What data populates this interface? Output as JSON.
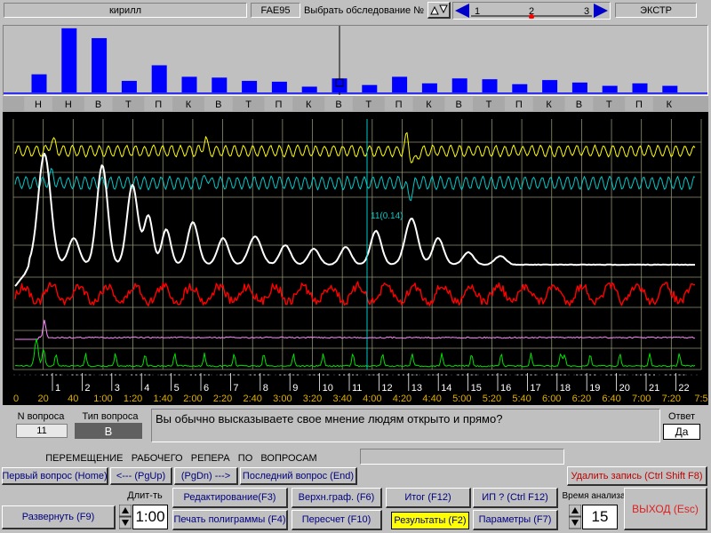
{
  "header": {
    "user_name": "кирилл",
    "exam_code": "FAE95",
    "select_exam_label": "Выбрать обследование №",
    "exam_pages": [
      "1",
      "2",
      "3"
    ],
    "mode_label": "ЭКСТР"
  },
  "histogram": {
    "categories": [
      "Н",
      "Н",
      "В",
      "Т",
      "П",
      "К",
      "В",
      "Т",
      "П",
      "К",
      "В",
      "Т",
      "П",
      "К",
      "В",
      "Т",
      "П",
      "К",
      "В",
      "Т",
      "П",
      "К"
    ],
    "values": [
      22,
      78,
      66,
      14,
      33,
      19,
      18,
      14,
      13,
      7,
      17,
      9,
      19,
      11,
      17,
      16,
      10,
      15,
      12,
      8,
      11,
      8
    ],
    "bar_color": "#0000ff"
  },
  "chart_data": {
    "type": "line",
    "x_tick_labels": [
      "0",
      "20",
      "40",
      "1:00",
      "1:20",
      "1:40",
      "2:00",
      "2:20",
      "2:40",
      "3:00",
      "3:20",
      "3:40",
      "4:00",
      "4:20",
      "4:40",
      "5:00",
      "5:20",
      "5:40",
      "6:00",
      "6:20",
      "6:40",
      "7:00",
      "7:20",
      "7:5"
    ],
    "question_markers": [
      "1",
      "2",
      "3",
      "4",
      "5",
      "6",
      "7",
      "8",
      "9",
      "10",
      "11",
      "12",
      "13",
      "14",
      "15",
      "16",
      "17",
      "18",
      "19",
      "20",
      "21",
      "22"
    ],
    "annotation": "11(0.14)",
    "series": [
      {
        "color": "#ffff00"
      },
      {
        "color": "#00c8c8"
      },
      {
        "color": "#ffffff"
      },
      {
        "color": "#ff0000"
      },
      {
        "color": "#ff88ff"
      },
      {
        "color": "#00e000"
      }
    ]
  },
  "question": {
    "number_label": "N вопроса",
    "number_value": "11",
    "type_label": "Тип вопроса",
    "type_value": "В",
    "text": "Вы обычно высказываете свое мнение людям открыто и прямо?",
    "answer_label": "Ответ",
    "answer_value": "Да"
  },
  "nav": {
    "section_title": "ПЕРЕМЕЩЕНИЕ   РАБОЧЕГО   РЕПЕРА   ПО   ВОПРОСАМ",
    "first": "Первый вопрос (Home)",
    "prev": "<--- (PgUp)",
    "next": "(PgDn) --->",
    "last": "Последний вопрос (End)"
  },
  "controls": {
    "delete": "Удалить запись (Ctrl Shift F8)",
    "expand": "Развернуть  (F9)",
    "duration_label": "Длит-ть",
    "duration_value": "1:00",
    "edit": "Редактирование(F3)",
    "print": "Печать полиграммы (F4)",
    "top_graph": "Верхн.граф. (F6)",
    "recalc": "Пересчет   (F10)",
    "total": "Итог (F12)",
    "results": "Результаты (F2)",
    "ip": "ИП ?  (Ctrl F12)",
    "params": "Параметры (F7)",
    "analysis_time_label": "Время анализа",
    "analysis_time_value": "15",
    "exit": "ВЫХОД (Esc)"
  }
}
